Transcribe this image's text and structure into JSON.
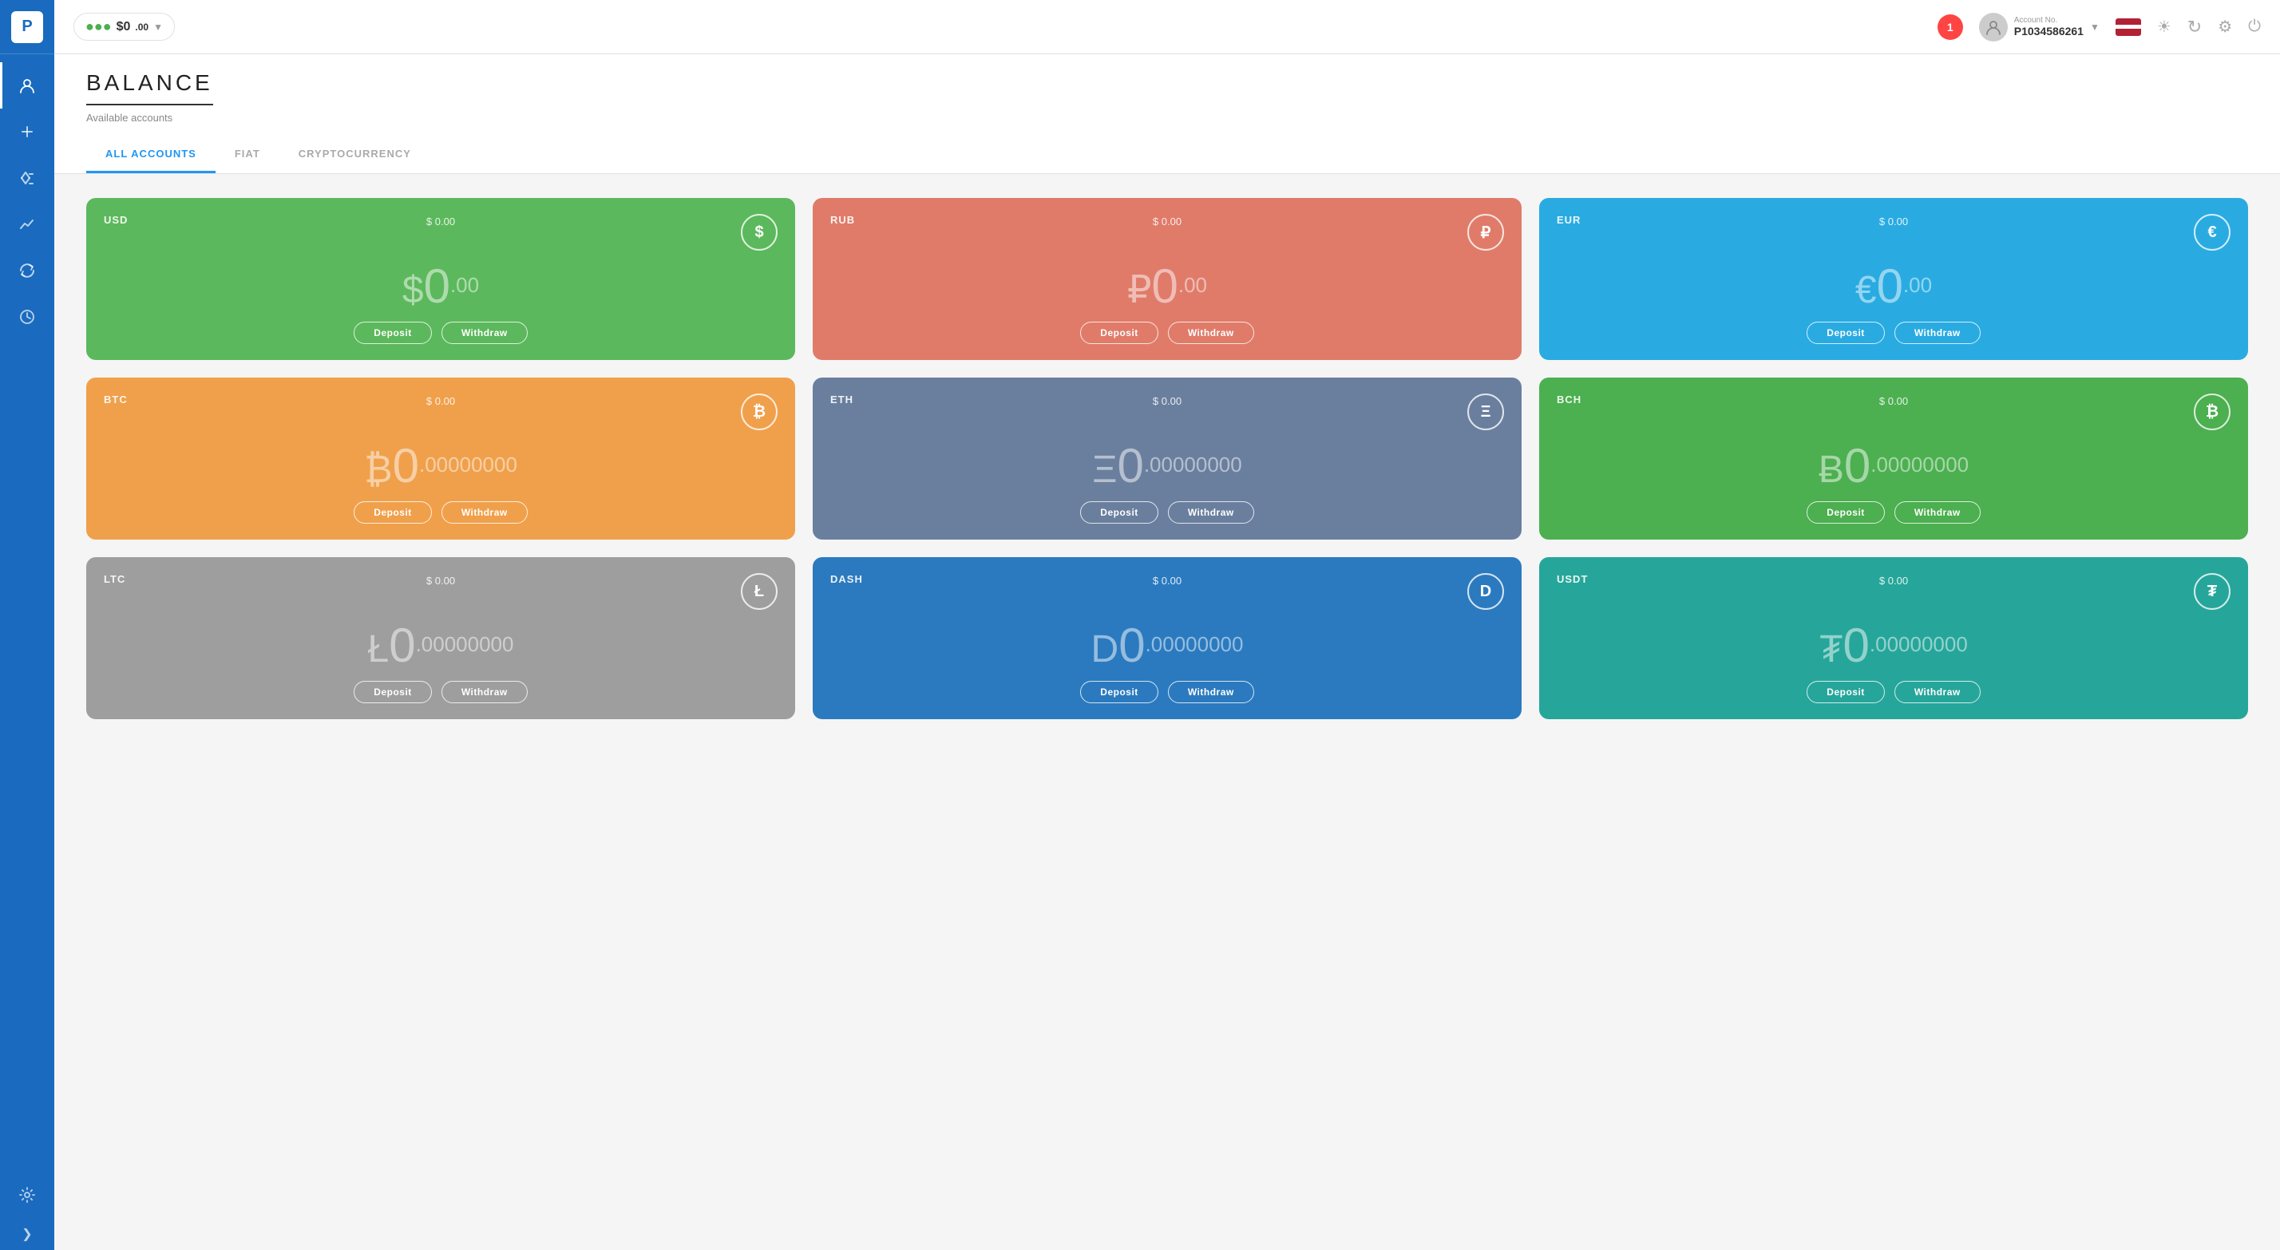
{
  "sidebar": {
    "logo": "P",
    "items": [
      {
        "id": "profile",
        "icon": "👤",
        "active": true
      },
      {
        "id": "add",
        "icon": "➕",
        "active": false
      },
      {
        "id": "navigation",
        "icon": "✈",
        "active": false
      },
      {
        "id": "analytics",
        "icon": "📈",
        "active": false
      },
      {
        "id": "refresh",
        "icon": "🔄",
        "active": false
      },
      {
        "id": "history",
        "icon": "🕐",
        "active": false
      },
      {
        "id": "settings",
        "icon": "⚙",
        "active": false
      }
    ],
    "expand_label": "❯"
  },
  "topbar": {
    "balance": "$0",
    "balance_cents": ".00",
    "notification_count": "1",
    "account_no_label": "Account No.",
    "account_no": "P1034586261",
    "icons": [
      "☀",
      "↻",
      "⚙",
      "⏻"
    ]
  },
  "page": {
    "title": "BALANCE",
    "subtitle": "Available accounts"
  },
  "tabs": [
    {
      "id": "all",
      "label": "ALL ACCOUNTS",
      "active": true
    },
    {
      "id": "fiat",
      "label": "FIAT",
      "active": false
    },
    {
      "id": "crypto",
      "label": "CRYPTOCURRENCY",
      "active": false
    }
  ],
  "cards": [
    {
      "id": "usd",
      "code": "USD",
      "usd_value": "$ 0.00",
      "icon": "$",
      "amount_symbol": "$",
      "amount_int": "0",
      "amount_dec": ".00",
      "color_class": "card-usd",
      "deposit_label": "Deposit",
      "withdraw_label": "Withdraw"
    },
    {
      "id": "rub",
      "code": "RUB",
      "usd_value": "$ 0.00",
      "icon": "₽",
      "amount_symbol": "₽",
      "amount_int": "0",
      "amount_dec": ".00",
      "color_class": "card-rub",
      "deposit_label": "Deposit",
      "withdraw_label": "Withdraw"
    },
    {
      "id": "eur",
      "code": "EUR",
      "usd_value": "$ 0.00",
      "icon": "€",
      "amount_symbol": "€",
      "amount_int": "0",
      "amount_dec": ".00",
      "color_class": "card-eur",
      "deposit_label": "Deposit",
      "withdraw_label": "Withdraw"
    },
    {
      "id": "btc",
      "code": "BTC",
      "usd_value": "$ 0.00",
      "icon": "₿",
      "amount_symbol": "₿",
      "amount_int": "0",
      "amount_dec": ".00000000",
      "color_class": "card-btc",
      "deposit_label": "Deposit",
      "withdraw_label": "Withdraw"
    },
    {
      "id": "eth",
      "code": "ETH",
      "usd_value": "$ 0.00",
      "icon": "Ξ",
      "amount_symbol": "Ξ",
      "amount_int": "0",
      "amount_dec": ".00000000",
      "color_class": "card-eth",
      "deposit_label": "Deposit",
      "withdraw_label": "Withdraw"
    },
    {
      "id": "bch",
      "code": "BCH",
      "usd_value": "$ 0.00",
      "icon": "₿",
      "amount_symbol": "Ƀ",
      "amount_int": "0",
      "amount_dec": ".00000000",
      "color_class": "card-bch",
      "deposit_label": "Deposit",
      "withdraw_label": "Withdraw"
    },
    {
      "id": "ltc",
      "code": "LTC",
      "usd_value": "$ 0.00",
      "icon": "Ł",
      "amount_symbol": "Ł",
      "amount_int": "0",
      "amount_dec": ".00000000",
      "color_class": "card-ltc",
      "deposit_label": "Deposit",
      "withdraw_label": "Withdraw"
    },
    {
      "id": "dash",
      "code": "DASH",
      "usd_value": "$ 0.00",
      "icon": "D",
      "amount_symbol": "D",
      "amount_int": "0",
      "amount_dec": ".00000000",
      "color_class": "card-dash",
      "deposit_label": "Deposit",
      "withdraw_label": "Withdraw"
    },
    {
      "id": "usdt",
      "code": "USDT",
      "usd_value": "$ 0.00",
      "icon": "₮",
      "amount_symbol": "₮",
      "amount_int": "0",
      "amount_dec": ".00000000",
      "color_class": "card-usdt",
      "deposit_label": "Deposit",
      "withdraw_label": "Withdraw"
    }
  ]
}
